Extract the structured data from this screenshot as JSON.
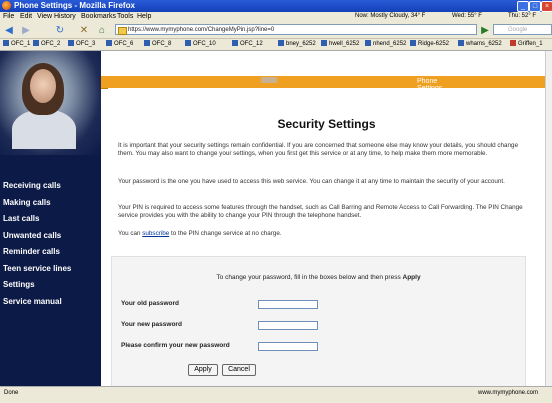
{
  "window": {
    "title": "Phone Settings - Mozilla Firefox"
  },
  "menu": [
    "File",
    "Edit",
    "View",
    "History",
    "Bookmarks",
    "Tools",
    "Help"
  ],
  "weather": [
    "Now: Mostly Cloudy, 34° F",
    "Wed: 55° F",
    "Thu: 52° F"
  ],
  "address": {
    "url": "https://www.mymyphone.com/ChangeMyPin.jsp?line=0",
    "search_placeholder": "Google"
  },
  "bookmarks": [
    "OFC_1",
    "OFC_2",
    "OFC_3",
    "OFC_6",
    "OFC_8",
    "OFC_10",
    "OFC_12",
    "bney_6252",
    "hwell_6252",
    "nhend_6252",
    "Ridge-6252",
    "whams_6252",
    "Griffen_1"
  ],
  "sidebar": {
    "items": [
      "Receiving calls",
      "Making calls",
      "Last calls",
      "Unwanted calls",
      "Reminder calls",
      "Teen service lines",
      "Settings",
      "Service manual"
    ]
  },
  "banner": {
    "text": "Phone Settings for 309-667-"
  },
  "page": {
    "title": "Security Settings",
    "para1": "It is important that your security settings remain confidential. If you are concerned that someone else may know your details, you should change them. You may also want to change your settings, when you first get this service or at any time, to help make them more memorable.",
    "para2": "Your password is the one you have used to access this web service. You can change it at any time to maintain the security of your account.",
    "para3": "Your PIN is required to access some features through the handset, such as Call Barring and Remote Access to Call Forwarding. The PIN Change service provides you with the ability to change your PIN through the telephone handset.",
    "para4_pre": "You can ",
    "para4_link": "subscribe",
    "para4_post": " to the PIN change service at no charge."
  },
  "form": {
    "intro_pre": "To change your password, fill in the boxes below and then press ",
    "intro_bold": "Apply",
    "old_label": "Your old password",
    "new_label": "Your new password",
    "confirm_label": "Please confirm your new password",
    "apply": "Apply",
    "cancel": "Cancel"
  },
  "status": {
    "left": "Done",
    "right": "www.mymyphone.com"
  }
}
